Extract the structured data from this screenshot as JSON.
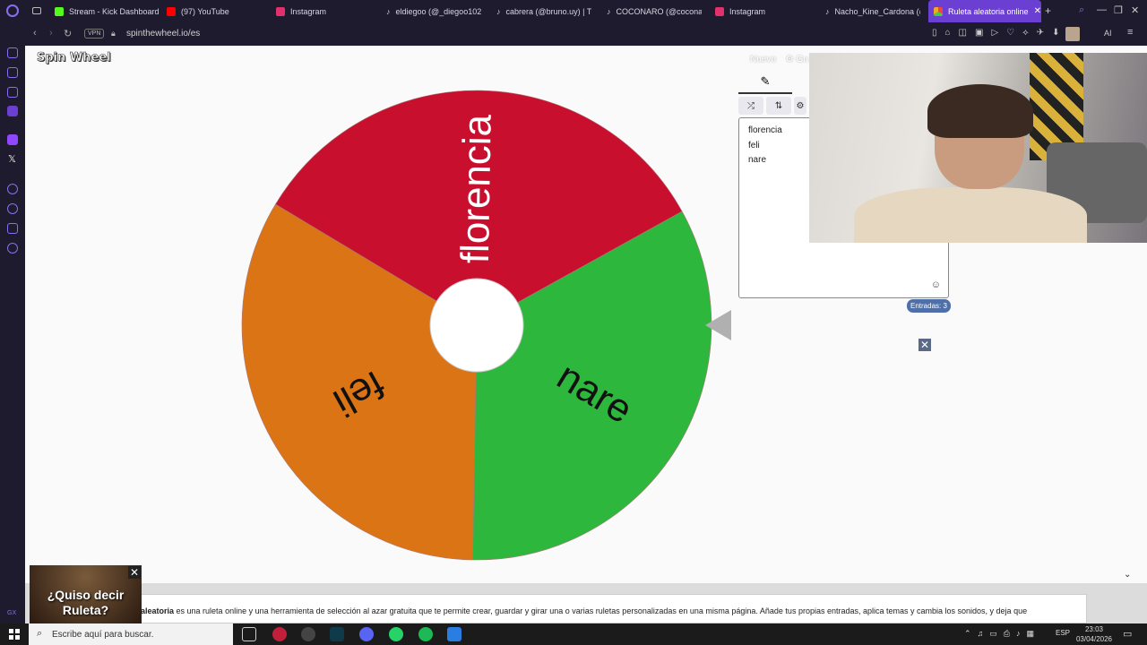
{
  "tabs": [
    {
      "label": "Stream - Kick Dashboard",
      "color": "#53fc18"
    },
    {
      "label": "(97) YouTube",
      "color": "#ff0000"
    },
    {
      "label": "Instagram",
      "color": "#e1306c"
    },
    {
      "label": "eldiegoo (@_diegoo102",
      "color": "#ffffff"
    },
    {
      "label": "cabrera (@bruno.uy) | T",
      "color": "#ffffff"
    },
    {
      "label": "COCONARO (@cocona",
      "color": "#ffffff"
    },
    {
      "label": "Instagram",
      "color": "#e1306c"
    },
    {
      "label": "Nacho_Kine_Cardona (@",
      "color": "#ffffff"
    },
    {
      "label": "Ruleta aleatoria online",
      "color": "#f5a623"
    }
  ],
  "address": {
    "vpn": "VPN",
    "url": "spinthewheel.io/es"
  },
  "site": {
    "logo": "Spin Wheel",
    "new_label": "Nuevo",
    "save_label": "Gu"
  },
  "wheel": {
    "segments": [
      {
        "label": "florencia",
        "color": "#c8102e"
      },
      {
        "label": "nare",
        "color": "#2db83d"
      },
      {
        "label": "feli",
        "color": "#db7415"
      }
    ]
  },
  "entries_panel": {
    "entries": [
      "florencia",
      "feli",
      "nare"
    ],
    "count_label": "Entradas: 3"
  },
  "ad": {
    "text_line1": "¿Quiso decir",
    "text_line2": "Ruleta?"
  },
  "description": {
    "bold": "aleatoria",
    "text": " es una ruleta online y una herramienta de selección al azar gratuita que te permite crear, guardar y girar una o varias ruletas personalizadas en una misma página. Añade tus propias entradas, aplica temas y cambia los sonidos, y deja que"
  },
  "taskbar": {
    "search_placeholder": "Escribe aquí para buscar.",
    "lang": "ESP",
    "time": "23:03",
    "date": "03/04/2026"
  }
}
